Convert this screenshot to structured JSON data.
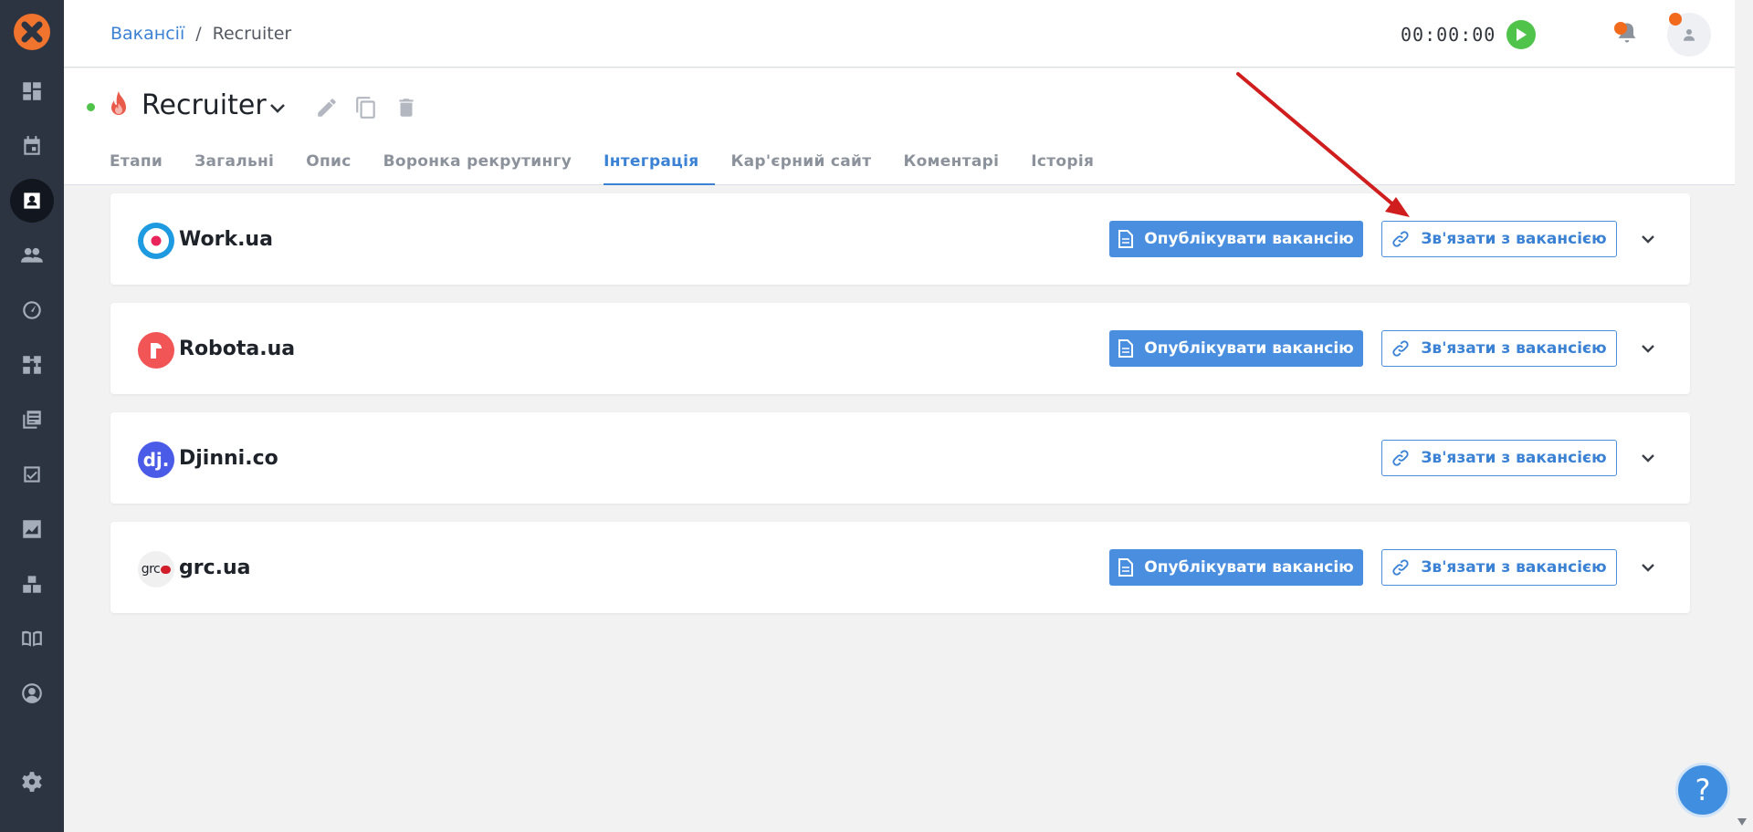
{
  "breadcrumb": {
    "parent": "Вакансії",
    "separator": "/",
    "current": "Recruiter"
  },
  "timer": {
    "value": "00:00:00"
  },
  "vacancy": {
    "title": "Recruiter"
  },
  "tabs": [
    {
      "label": "Етапи"
    },
    {
      "label": "Загальні"
    },
    {
      "label": "Опис"
    },
    {
      "label": "Воронка рекрутингу"
    },
    {
      "label": "Інтеграція",
      "active": true
    },
    {
      "label": "Кар'єрний сайт"
    },
    {
      "label": "Коментарі"
    },
    {
      "label": "Історія"
    }
  ],
  "integrations": [
    {
      "name": "Work.ua",
      "logo": "workua-logo",
      "publish_label": "Опублікувати вакансію",
      "link_label": "Зв'язати з вакансією"
    },
    {
      "name": "Robota.ua",
      "logo": "robotaua-logo",
      "publish_label": "Опублікувати вакансію",
      "link_label": "Зв'язати з вакансією"
    },
    {
      "name": "Djinni.co",
      "logo": "djinni-logo",
      "logo_text": "dj.",
      "link_label": "Зв'язати з вакансією"
    },
    {
      "name": "grc.ua",
      "logo": "grcua-logo",
      "logo_text": "grc",
      "publish_label": "Опублікувати вакансію",
      "link_label": "Зв'язати з вакансією"
    }
  ],
  "help": {
    "label": "?"
  },
  "colors": {
    "accent": "#3b82d4",
    "sidebar": "#2d3441",
    "status_active": "#4fc34a",
    "notify": "#f26a1b",
    "annotation": "#d01e1e"
  },
  "icons": [
    "logo-icon",
    "dashboard-icon",
    "calendar-icon",
    "vacancies-icon",
    "candidates-icon",
    "speedometer-icon",
    "pipeline-icon",
    "library-icon",
    "tasks-icon",
    "reports-icon",
    "integrations-icon",
    "knowledge-book-icon",
    "profile-icon",
    "gear-icon"
  ]
}
